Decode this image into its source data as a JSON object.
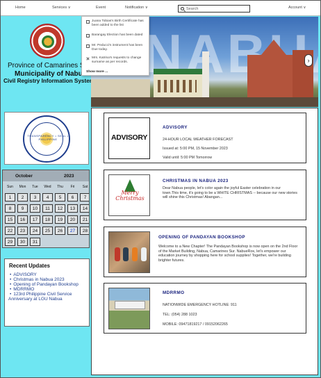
{
  "nav": {
    "home": "Home",
    "services": "Services ∨",
    "event": "Event",
    "notification": "Notification ∨",
    "search_placeholder": "Search",
    "account": "Account ∨"
  },
  "notifications": {
    "items": [
      {
        "text": "Juana Tobias's Birth Certificate has been added to the list",
        "icon": "document-icon"
      },
      {
        "text": "Barangay Election has been dated",
        "icon": "document-icon"
      },
      {
        "text": "Mr. Peducci's instrument has been Due today.",
        "icon": "document-icon"
      },
      {
        "text": "Mrs. Katrina's requests to change surname as per records.",
        "icon": "close-icon"
      }
    ],
    "show_more": "Show more ..."
  },
  "header": {
    "province": "Province of Camarines S",
    "municipality": "Municipality of Nabua",
    "office": "Civil Registry Information System",
    "banner_text": "NABUA"
  },
  "transparency_seal": "TRANSPARENCY • SEAL • PHILIPPINE",
  "calendar": {
    "month": "October",
    "year": "2023",
    "days_of_week": [
      "Sun",
      "Mon",
      "Tue",
      "Wed",
      "Thu",
      "Fri",
      "Sat"
    ],
    "weeks": [
      [
        "1",
        "2",
        "3",
        "4",
        "5",
        "6",
        "7"
      ],
      [
        "8",
        "9",
        "10",
        "11",
        "12",
        "13",
        "14"
      ],
      [
        "15",
        "16",
        "17",
        "18",
        "19",
        "20",
        "21"
      ],
      [
        "22",
        "23",
        "24",
        "25",
        "26",
        "27",
        "28"
      ],
      [
        "29",
        "30",
        "31",
        "",
        "",
        "",
        ""
      ]
    ],
    "today": "27"
  },
  "recent_updates": {
    "title": "Recent Updates",
    "items": [
      "ADVISORY",
      "Christmas in Nabua 2023",
      "Opening of Pandayan Bookshop",
      "MDRRMO",
      "123rd Philippine Civil Service Anniversary at LGU Nabua"
    ]
  },
  "posts": [
    {
      "thumb_label": "ADVISORY",
      "title": "ADVISORY",
      "lines": [
        "24-HOUR LOCAL WEATHER FORECAST",
        "Issued at:  5:00 PM, 15 November 2023",
        "Valid until: 5:00 PM Tomorrow"
      ]
    },
    {
      "thumb_label": "Merry Christmas",
      "title": "CHRISTMAS IN NABUA 2023",
      "lines": [
        "Dear Nabua people, let's color again the joyful Easter celebration in our",
        "town.This time, it's going to be a WHITE CHRISTMAS -- because our new stories",
        "will shine this Christmas! Abangan..."
      ]
    },
    {
      "thumb_label": "",
      "title": "OPENING OF PANDAYAN BOOKSHOP",
      "lines": [
        "Welcome to a New Chapter! The Pandayan Bookshop is now open on the 2nd Floor of the Market Building, Nabua, Camarines Sur. NabueRos, let's empower our education journey by shopping here for school supplies! Together, we're building brighter futures."
      ]
    },
    {
      "thumb_label": "",
      "title": "MDRRMO",
      "lines": [
        "NATIONWIDE EMERGENCY HOTLINE: 911",
        "TEL: (054) 288 1023",
        "MOBILE: 09471819217 / 09152062265"
      ]
    }
  ],
  "colors": {
    "page_bg": "#6ee6f2",
    "accent_title": "#1a237e",
    "link": "#1f3e8e"
  }
}
